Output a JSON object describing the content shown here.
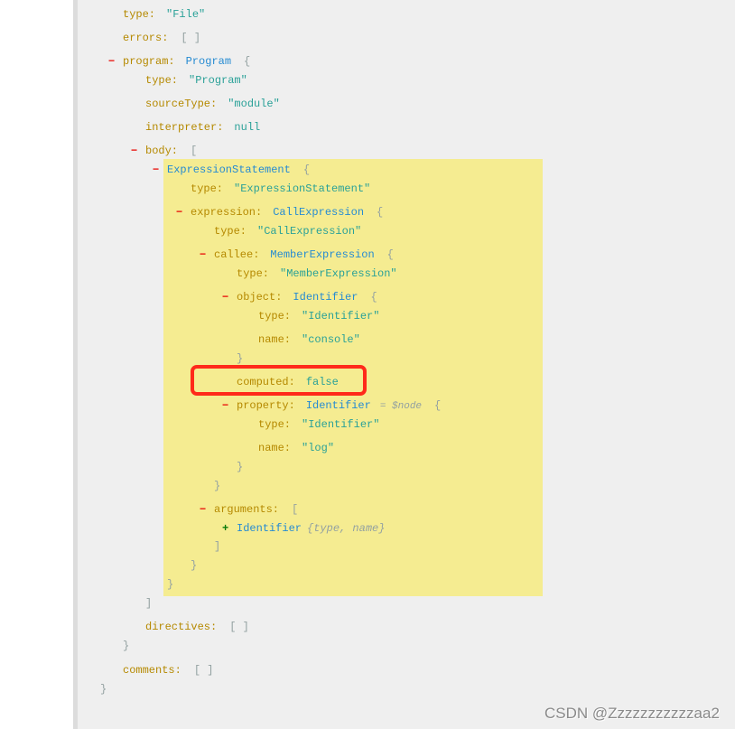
{
  "colors": {
    "key": "#b58900",
    "string": "#2aa198",
    "type": "#268bd2",
    "bracket": "#93a1a1",
    "collapse": "#e8100a",
    "expand": "#0a7a0a",
    "highlight": "#f5ec91",
    "annotation": "#ff2a1a"
  },
  "lines": [
    {
      "key": "type:",
      "str": "″File″"
    },
    {
      "key": "errors:",
      "br": "[ ]"
    },
    {
      "toggle": "−",
      "key": "program:",
      "type": "Program",
      "br": "{"
    },
    {
      "key": "type:",
      "str": "″Program″"
    },
    {
      "key": "sourceType:",
      "str": "″module″"
    },
    {
      "key": "interpreter:",
      "lit": "null"
    },
    {
      "toggle": "−",
      "key": "body:",
      "br": "["
    },
    {
      "toggle": "−",
      "ntype": "ExpressionStatement",
      "br": "{"
    },
    {
      "key": "type:",
      "str": "″ExpressionStatement″"
    },
    {
      "toggle": "−",
      "key": "expression:",
      "type": "CallExpression",
      "br": "{"
    },
    {
      "key": "type:",
      "str": "″CallExpression″"
    },
    {
      "toggle": "−",
      "key": "callee:",
      "type": "MemberExpression",
      "br": "{"
    },
    {
      "key": "type:",
      "str": "″MemberExpression″"
    },
    {
      "toggle": "−",
      "key": "object:",
      "type": "Identifier",
      "br": "{"
    },
    {
      "key": "type:",
      "str": "″Identifier″"
    },
    {
      "key": "name:",
      "str": "″console″"
    },
    {
      "close": "}"
    },
    {
      "key": "computed:",
      "lit": "false"
    },
    {
      "toggle": "−",
      "key": "property:",
      "type": "Identifier",
      "hint": "= $node",
      "br": "{"
    },
    {
      "key": "type:",
      "str": "″Identifier″"
    },
    {
      "key": "name:",
      "str": "″log″"
    },
    {
      "close": "}"
    },
    {
      "close": "}"
    },
    {
      "toggle": "−",
      "key": "arguments:",
      "br": "["
    },
    {
      "toggle": "+",
      "ntype": "Identifier",
      "summary": "{type, name}"
    },
    {
      "close": "]"
    },
    {
      "close": "}"
    },
    {
      "close": "}"
    },
    {
      "close": "]"
    },
    {
      "key": "directives:",
      "br": "[ ]"
    },
    {
      "close": "}"
    },
    {
      "key": "comments:",
      "br": "[ ]"
    },
    {
      "close": "}"
    }
  ],
  "watermark": "CSDN @Zzzzzzzzzzzaa2"
}
